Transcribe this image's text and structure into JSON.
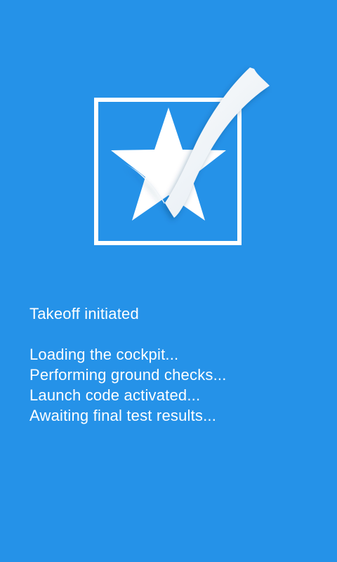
{
  "theme": {
    "background": "#2592e8",
    "foreground": "#ffffff"
  },
  "logo": {
    "icon": "star-checkmark-logo-icon"
  },
  "status": {
    "heading": "Takeoff initiated",
    "steps": [
      "Loading the cockpit...",
      "Performing ground checks...",
      "Launch code activated...",
      "Awaiting final test results..."
    ]
  }
}
